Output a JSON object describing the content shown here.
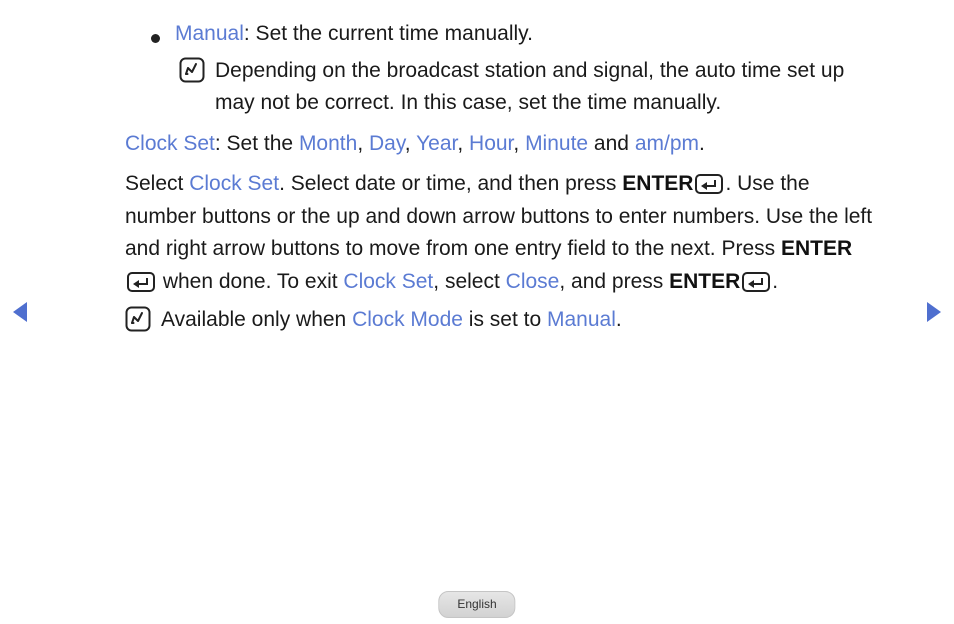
{
  "bullet": {
    "term": "Manual",
    "rest": ": Set the current time manually."
  },
  "note1": "Depending on the broadcast station and signal, the auto time set up may not be correct. In this case, set the time manually.",
  "clockset_line": {
    "term": "Clock Set",
    "mid1": ": Set the ",
    "month": "Month",
    "c1": ", ",
    "day": "Day",
    "c2": ", ",
    "year": "Year",
    "c3": ", ",
    "hour": "Hour",
    "c4": ", ",
    "minute": "Minute",
    "and": " and ",
    "ampm": "am/pm",
    "end": "."
  },
  "body": {
    "p1_a": "Select ",
    "p1_term": "Clock Set",
    "p1_b": ". Select date or time, and then press ",
    "enter1": "ENTER",
    "p1_c": ". Use the number buttons or the up and down arrow buttons to enter numbers. Use the left and right arrow buttons to move from one entry field to the next. Press ",
    "enter2": "ENTER",
    "p1_d": " when done. To exit ",
    "p1_term2": "Clock Set",
    "p1_e": ", select ",
    "close": "Close",
    "p1_f": ", and press ",
    "enter3": "ENTER",
    "p1_g": "."
  },
  "note2": {
    "a": "Available only when ",
    "term1": "Clock Mode",
    "b": " is set to ",
    "term2": "Manual",
    "c": "."
  },
  "footer": {
    "language": "English"
  },
  "colors": {
    "term": "#5b7bd3",
    "text": "#1a1a1a"
  }
}
